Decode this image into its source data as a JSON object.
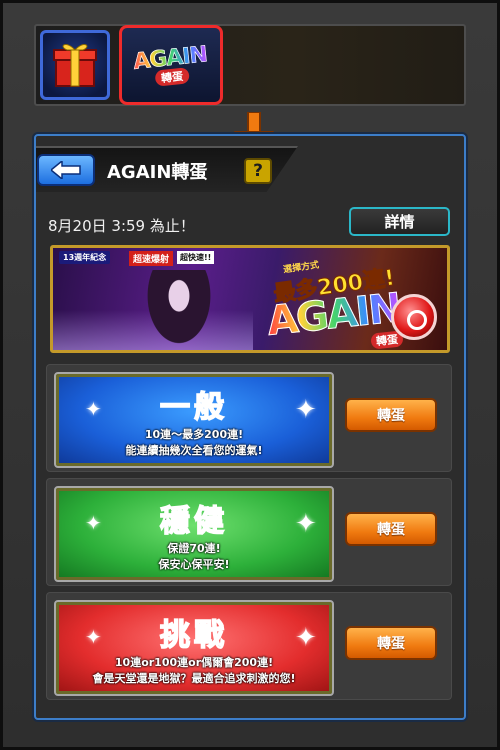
{
  "tabs": {
    "again_logo_main": "AGAIN",
    "again_logo_sub": "轉蛋"
  },
  "header": {
    "title": "AGAIN轉蛋",
    "help_label": "?"
  },
  "info": {
    "deadline": "8月20日 3:59 為止！",
    "detail_label": "詳情"
  },
  "banner": {
    "tag_anniversary": "13週年紀念",
    "tag_ultimate": "超速爆射",
    "tag_last": "超快速!!",
    "line_small": "選擇方式",
    "line_big": "最多200連!",
    "logo": "AGAIN",
    "logo_sub": "轉蛋"
  },
  "options": [
    {
      "title": "一般",
      "desc_line1": "10連～最多200連!",
      "desc_line2": "能連續抽幾次全看您的運氣!",
      "button": "轉蛋",
      "color": "#1a5fd8"
    },
    {
      "title": "穩健",
      "desc_line1": "保證70連!",
      "desc_line2": "保安心保平安!",
      "button": "轉蛋",
      "color": "#2db03a"
    },
    {
      "title": "挑戰",
      "desc_line1": "10連or100連or偶爾會200連!",
      "desc_line2": "會是天堂還是地獄？最適合追求刺激的您!",
      "button": "轉蛋",
      "color": "#e32d2d"
    }
  ],
  "colors": {
    "panel_border": "#3d7ec9",
    "highlight_red": "#ee2b2b",
    "arrow_orange": "#f07a10",
    "detail_border": "#2bb7c8"
  },
  "icons": {
    "gift_tab": "gift-box-icon",
    "back": "back-arrow-icon",
    "pointer": "down-arrow-icon",
    "sparkle": "sparkle-icon"
  }
}
